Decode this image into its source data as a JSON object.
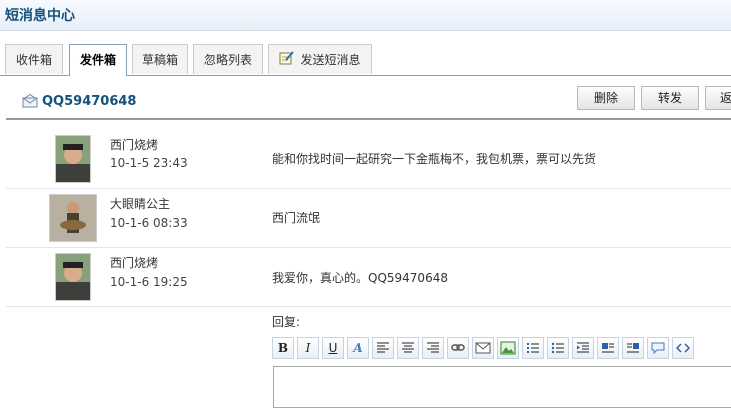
{
  "header": {
    "title": "短消息中心"
  },
  "tabs": [
    {
      "label": "收件箱",
      "active": false
    },
    {
      "label": "发件箱",
      "active": true
    },
    {
      "label": "草稿箱",
      "active": false
    },
    {
      "label": "忽略列表",
      "active": false
    },
    {
      "label": "发送短消息",
      "active": false,
      "icon": "pencil-paper-icon"
    }
  ],
  "conversation": {
    "title": "QQ59470648",
    "icon": "envelope-icon"
  },
  "actions": {
    "delete_label": "删除",
    "forward_label": "转发",
    "back_label": "返"
  },
  "messages": [
    {
      "name": "西门烧烤",
      "time": "10-1-5 23:43",
      "text": "能和你找时间一起研究一下金瓶梅不，我包机票，票可以先货"
    },
    {
      "name": "大眼睛公主",
      "time": "10-1-6 08:33",
      "text": "西门流氓"
    },
    {
      "name": "西门烧烤",
      "time": "10-1-6 19:25",
      "text": "我爱你，真心的。QQ59470648"
    }
  ],
  "reply": {
    "label": "回复:"
  },
  "toolbar": {
    "bold": "B",
    "italic": "I",
    "underline": "U",
    "font_color": "A",
    "icons": [
      "bold-icon",
      "italic-icon",
      "underline-icon",
      "font-color-icon",
      "align-left-icon",
      "align-center-icon",
      "align-right-icon",
      "link-icon",
      "email-icon",
      "image-icon",
      "ordered-list-icon",
      "unordered-list-icon",
      "indent-icon",
      "float-left-icon",
      "float-right-icon",
      "quote-icon",
      "code-icon"
    ]
  },
  "colors": {
    "title_blue": "#15517d",
    "border": "#8aa0b8"
  }
}
